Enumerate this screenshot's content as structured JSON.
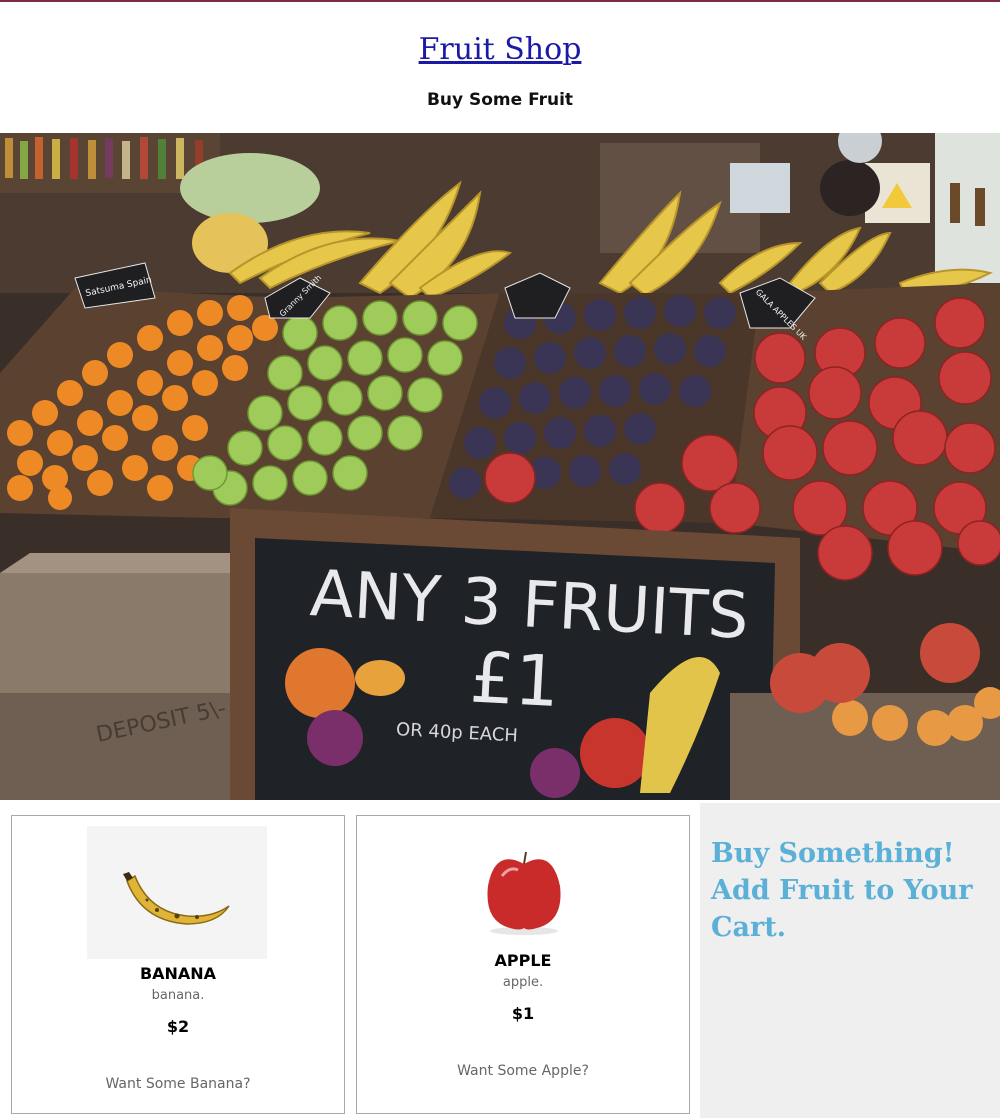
{
  "header": {
    "site_title": "Fruit Shop",
    "tagline": "Buy Some Fruit"
  },
  "hero": {
    "sign_line1": "ANY 3 FRUITS",
    "sign_line2": "£1",
    "sign_line3": "OR 40p EACH",
    "crate_text": "DEPOSIT 5\\-",
    "tags": [
      "Satsuma Spain",
      "Granny Smith",
      "GALA APPLES UK"
    ]
  },
  "products": [
    {
      "name": "BANANA",
      "description": "banana.",
      "price": "$2",
      "cta": "Want Some Banana?",
      "icon": "banana-image"
    },
    {
      "name": "APPLE",
      "description": "apple.",
      "price": "$1",
      "cta": "Want Some Apple?",
      "icon": "apple-image"
    }
  ],
  "cart": {
    "message": "Buy Something! Add Fruit to Your Cart."
  },
  "colors": {
    "title_link": "#1a1aa6",
    "cart_text": "#5ab0d6",
    "cart_bg": "#efefef",
    "top_border": "#7a2a4a"
  }
}
